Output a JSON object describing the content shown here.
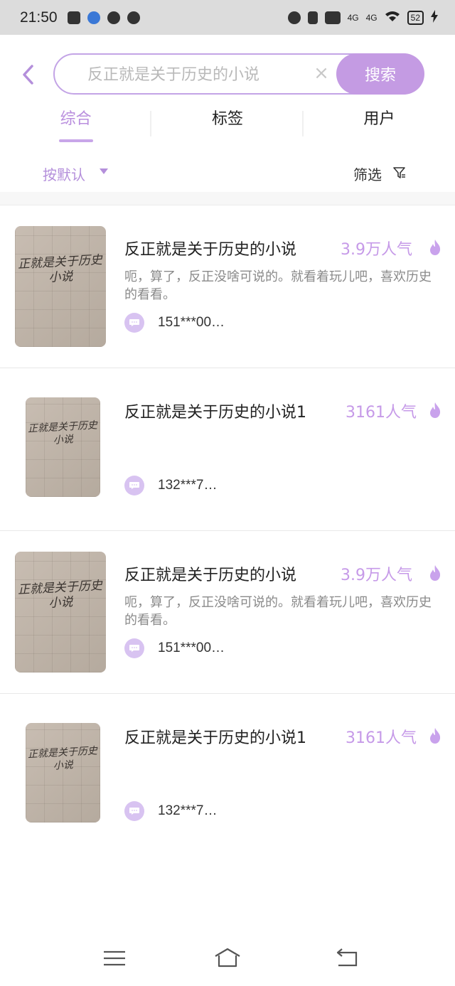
{
  "status_bar": {
    "time": "21:50",
    "left_icons": [
      "mail-icon",
      "paw-icon",
      "link-icon",
      "compass-icon"
    ],
    "right_icons": [
      "alarm-icon",
      "vibrate-icon",
      "hd-icon",
      "4g-signal-icon",
      "4g-signal-icon",
      "wifi-icon",
      "battery-icon",
      "charging-icon"
    ],
    "network_1": "4G",
    "network_2": "4G",
    "battery_level": "52"
  },
  "search": {
    "placeholder": "反正就是关于历史的小说",
    "button_label": "搜索"
  },
  "tabs": [
    {
      "label": "综合",
      "active": true
    },
    {
      "label": "标签",
      "active": false
    },
    {
      "label": "用户",
      "active": false
    }
  ],
  "filter": {
    "sort_label": "按默认",
    "filter_label": "筛选"
  },
  "results": [
    {
      "title": "反正就是关于历史的小说",
      "popularity": "3.9万人气",
      "description": "呃，算了，反正没啥可说的。就看着玩儿吧，喜欢历史的看看。",
      "author": "151***00…",
      "cover_text": "正就是关于历史小说"
    },
    {
      "title": "反正就是关于历史的小说1",
      "popularity": "3161人气",
      "description": "",
      "author": "132***7…",
      "cover_text": "正就是关于历史小说"
    },
    {
      "title": "反正就是关于历史的小说",
      "popularity": "3.9万人气",
      "description": "呃，算了，反正没啥可说的。就看着玩儿吧，喜欢历史的看看。",
      "author": "151***00…",
      "cover_text": "正就是关于历史小说"
    },
    {
      "title": "反正就是关于历史的小说1",
      "popularity": "3161人气",
      "description": "",
      "author": "132***7…",
      "cover_text": "正就是关于历史小说"
    }
  ],
  "colors": {
    "accent": "#c49be3",
    "accent_text": "#b98ede",
    "popularity": "#c69ae8"
  },
  "nav_bar": [
    "menu-icon",
    "home-icon",
    "back-icon"
  ]
}
